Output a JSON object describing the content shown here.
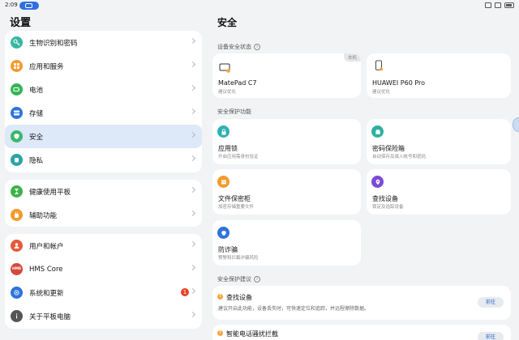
{
  "status_bar": {
    "time": "2:09"
  },
  "left": {
    "title": "设置",
    "groups": [
      [
        {
          "label": "生物识别和密码",
          "icon": "key-icon",
          "color": "#37b7a0"
        },
        {
          "label": "应用和服务",
          "icon": "apps-grid-icon",
          "color": "#f29b2e"
        },
        {
          "label": "电池",
          "icon": "battery-icon",
          "color": "#34b557"
        },
        {
          "label": "存储",
          "icon": "storage-icon",
          "color": "#2d74db"
        },
        {
          "label": "安全",
          "icon": "shield-icon",
          "color": "#39b86b"
        },
        {
          "label": "隐私",
          "icon": "privacy-hand-icon",
          "color": "#2fa3a5"
        }
      ],
      [
        {
          "label": "健康使用平板",
          "icon": "hourglass-icon",
          "color": "#3bb34a"
        },
        {
          "label": "辅助功能",
          "icon": "hand-icon",
          "color": "#f29b2e"
        }
      ],
      [
        {
          "label": "用户和帐户",
          "icon": "user-icon",
          "color": "#e45a3a"
        },
        {
          "label": "HMS Core",
          "icon": "hms-icon",
          "color": "#d24a3c"
        },
        {
          "label": "系统和更新",
          "icon": "gear-icon",
          "color": "#2d74db",
          "badge": "1"
        },
        {
          "label": "关于平板电脑",
          "icon": "info-icon",
          "color": "#555555"
        }
      ]
    ]
  },
  "right": {
    "title": "安全",
    "device_section": "设备安全状态",
    "devices": [
      {
        "name": "MatePad C7",
        "status": "建议优化",
        "tag": "本机"
      },
      {
        "name": "HUAWEI P60 Pro",
        "status": "建议优化"
      }
    ],
    "feature_section": "安全保护功能",
    "features": [
      {
        "title": "应用锁",
        "sub": "开启应用需身份验证",
        "color": "#2fb0b3",
        "icon": "lock-icon"
      },
      {
        "title": "密码保险箱",
        "sub": "自动保存及填入帐号和密码",
        "color": "#2fb0a0",
        "icon": "safe-icon"
      },
      {
        "title": "文件保密柜",
        "sub": "加密存储重要文件",
        "color": "#f29b2e",
        "icon": "folder-icon"
      },
      {
        "title": "查找设备",
        "sub": "锁定及追踪设备",
        "color": "#7a4bd6",
        "icon": "location-icon"
      },
      {
        "title": "防诈骗",
        "sub": "预警和拦截诈骗风险",
        "color": "#2d74db",
        "icon": "anti-fraud-icon"
      }
    ],
    "suggest_section": "安全保护建议",
    "suggestions": [
      {
        "title": "查找设备",
        "sub": "建议开启此功能，设备丢失时，可快速定位和追踪，并远程擦除数据。",
        "button": "前往"
      },
      {
        "title": "智能电话骚扰拦截",
        "button": "前往"
      }
    ]
  }
}
